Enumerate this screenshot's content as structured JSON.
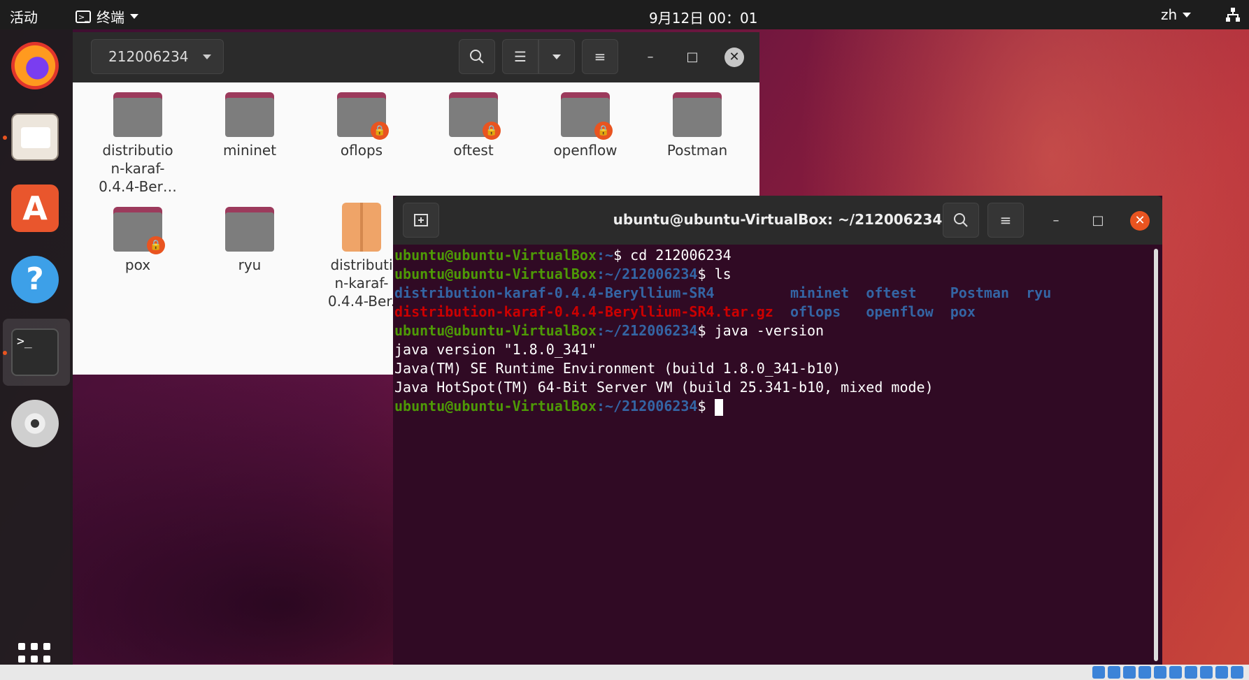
{
  "topbar": {
    "activities": "活动",
    "app_menu": "终端",
    "clock": "9月12日  00：01",
    "language": "zh"
  },
  "dock": {
    "items": [
      "firefox",
      "files",
      "software",
      "help",
      "terminal",
      "disc"
    ]
  },
  "file_manager": {
    "path": "212006234",
    "files": [
      {
        "label": "distributio\nn-karaf-\n0.4.4-Ber…",
        "type": "folder",
        "locked": false
      },
      {
        "label": "mininet",
        "type": "folder",
        "locked": false
      },
      {
        "label": "oflops",
        "type": "folder",
        "locked": true
      },
      {
        "label": "oftest",
        "type": "folder",
        "locked": true
      },
      {
        "label": "openflow",
        "type": "folder",
        "locked": true
      },
      {
        "label": "Postman",
        "type": "folder",
        "locked": false
      },
      {
        "label": "pox",
        "type": "folder",
        "locked": true
      },
      {
        "label": "ryu",
        "type": "folder",
        "locked": false
      },
      {
        "label": "distributi\nn-karaf-\n0.4.4-Ber.",
        "type": "archive",
        "locked": false
      }
    ]
  },
  "terminal": {
    "title": "ubuntu@ubuntu-VirtualBox: ~/212006234",
    "prompt_user": "ubuntu@ubuntu-VirtualBox",
    "lines": {
      "l1_path": ":~",
      "l1_cmd": "$ cd 212006234",
      "l2_path": ":~/212006234",
      "l2_cmd": "$ ls",
      "ls_row1_a": "distribution-karaf-0.4.4-Beryllium-SR4",
      "ls_row1_b": "mininet",
      "ls_row1_c": "oftest",
      "ls_row1_d": "Postman",
      "ls_row1_e": "ryu",
      "ls_row2_a": "distribution-karaf-0.4.4-Beryllium-SR4.tar.gz",
      "ls_row2_b": "oflops",
      "ls_row2_c": "openflow",
      "ls_row2_d": "pox",
      "l3_path": ":~/212006234",
      "l3_cmd": "$ java -version",
      "out1": "java version \"1.8.0_341\"",
      "out2": "Java(TM) SE Runtime Environment (build 1.8.0_341-b10)",
      "out3": "Java HotSpot(TM) 64-Bit Server VM (build 25.341-b10, mixed mode)",
      "l4_path": ":~/212006234",
      "l4_cmd": "$ "
    }
  }
}
